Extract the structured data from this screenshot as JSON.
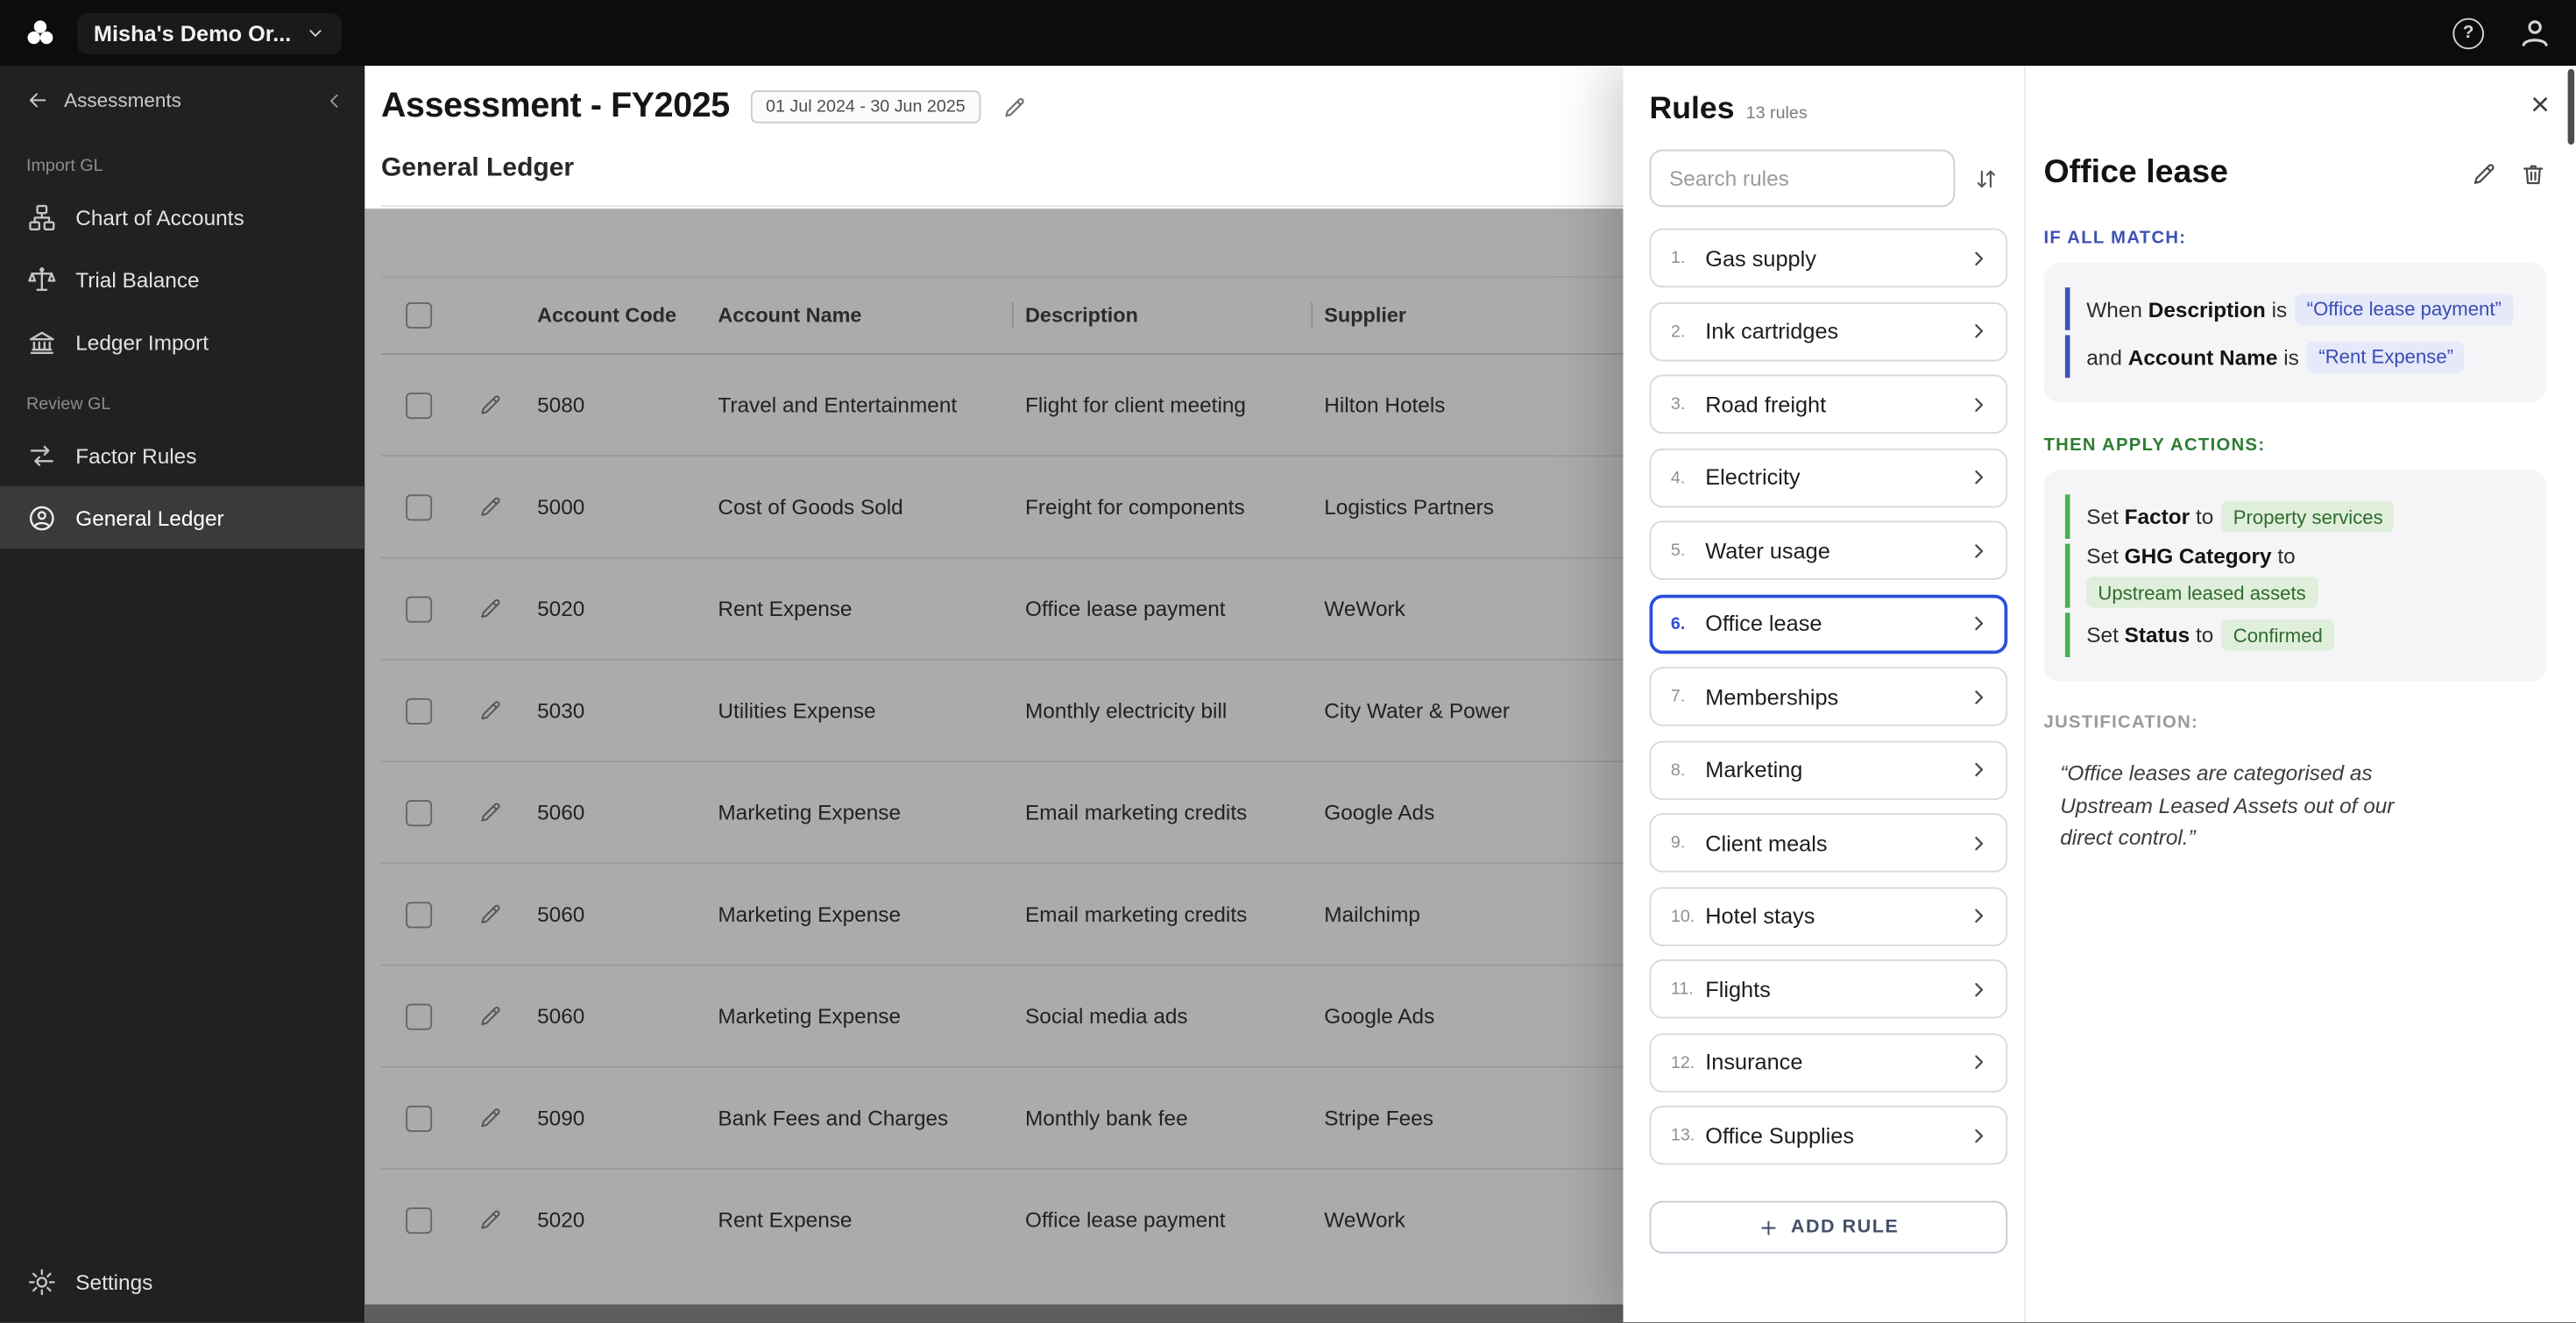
{
  "topbar": {
    "org_name": "Misha's Demo Or...",
    "help_glyph": "?"
  },
  "sidebar": {
    "back_label": "Assessments",
    "sections": [
      {
        "label": "Import GL",
        "items": [
          {
            "label": "Chart of Accounts"
          },
          {
            "label": "Trial Balance"
          },
          {
            "label": "Ledger Import"
          }
        ]
      },
      {
        "label": "Review GL",
        "items": [
          {
            "label": "Factor Rules"
          },
          {
            "label": "General Ledger",
            "selected": true
          }
        ]
      }
    ],
    "settings_label": "Settings"
  },
  "main": {
    "title": "Assessment - FY2025",
    "date_range": "01 Jul 2024 - 30 Jun 2025",
    "subtitle": "General Ledger",
    "table": {
      "columns": [
        "Account Code",
        "Account Name",
        "Description",
        "Supplier"
      ],
      "rows": [
        {
          "account_code": "5080",
          "account_name": "Travel and Entertainment",
          "description": "Flight for client meeting",
          "supplier": "Hilton Hotels"
        },
        {
          "account_code": "5000",
          "account_name": "Cost of Goods Sold",
          "description": "Freight for components",
          "supplier": "Logistics Partners"
        },
        {
          "account_code": "5020",
          "account_name": "Rent Expense",
          "description": "Office lease payment",
          "supplier": "WeWork"
        },
        {
          "account_code": "5030",
          "account_name": "Utilities Expense",
          "description": "Monthly electricity bill",
          "supplier": "City Water & Power"
        },
        {
          "account_code": "5060",
          "account_name": "Marketing Expense",
          "description": "Email marketing credits",
          "supplier": "Google Ads"
        },
        {
          "account_code": "5060",
          "account_name": "Marketing Expense",
          "description": "Email marketing credits",
          "supplier": "Mailchimp"
        },
        {
          "account_code": "5060",
          "account_name": "Marketing Expense",
          "description": "Social media ads",
          "supplier": "Google Ads"
        },
        {
          "account_code": "5090",
          "account_name": "Bank Fees and Charges",
          "description": "Monthly bank fee",
          "supplier": "Stripe Fees"
        },
        {
          "account_code": "5020",
          "account_name": "Rent Expense",
          "description": "Office lease payment",
          "supplier": "WeWork"
        }
      ]
    }
  },
  "rules_panel": {
    "title": "Rules",
    "count_label": "13 rules",
    "search_placeholder": "Search rules",
    "close_glyph": "×",
    "rules": [
      {
        "number": "1.",
        "name": "Gas supply"
      },
      {
        "number": "2.",
        "name": "Ink cartridges"
      },
      {
        "number": "3.",
        "name": "Road freight"
      },
      {
        "number": "4.",
        "name": "Electricity"
      },
      {
        "number": "5.",
        "name": "Water usage"
      },
      {
        "number": "6.",
        "name": "Office lease",
        "selected": true
      },
      {
        "number": "7.",
        "name": "Memberships"
      },
      {
        "number": "8.",
        "name": "Marketing"
      },
      {
        "number": "9.",
        "name": "Client meals"
      },
      {
        "number": "10.",
        "name": "Hotel stays"
      },
      {
        "number": "11.",
        "name": "Flights"
      },
      {
        "number": "12.",
        "name": "Insurance"
      },
      {
        "number": "13.",
        "name": "Office Supplies"
      }
    ],
    "add_rule_label": "ADD RULE"
  },
  "rule_detail": {
    "title": "Office lease",
    "if_label": "IF ALL MATCH:",
    "conditions": [
      {
        "prefix": "When",
        "field": "Description",
        "operator": "is",
        "value": "“Office lease payment”"
      },
      {
        "prefix": "and",
        "field": "Account Name",
        "operator": "is",
        "value": "“Rent Expense”"
      }
    ],
    "then_label": "THEN APPLY ACTIONS:",
    "actions": [
      {
        "prefix": "Set",
        "field": "Factor",
        "operator": "to",
        "value": "Property services"
      },
      {
        "prefix": "Set",
        "field": "GHG Category",
        "operator": "to",
        "value": "Upstream leased assets"
      },
      {
        "prefix": "Set",
        "field": "Status",
        "operator": "to",
        "value": "Confirmed"
      }
    ],
    "justification_label": "JUSTIFICATION:",
    "justification_text": "“Office leases are categorised as Upstream Leased Assets out of our direct control.”"
  },
  "colors": {
    "selected_rule_border": "#2c4ede",
    "condition_accent": "#3f51b5",
    "action_accent": "#4caf50",
    "if_label": "#3f51b5",
    "then_label": "#2e7d32"
  }
}
